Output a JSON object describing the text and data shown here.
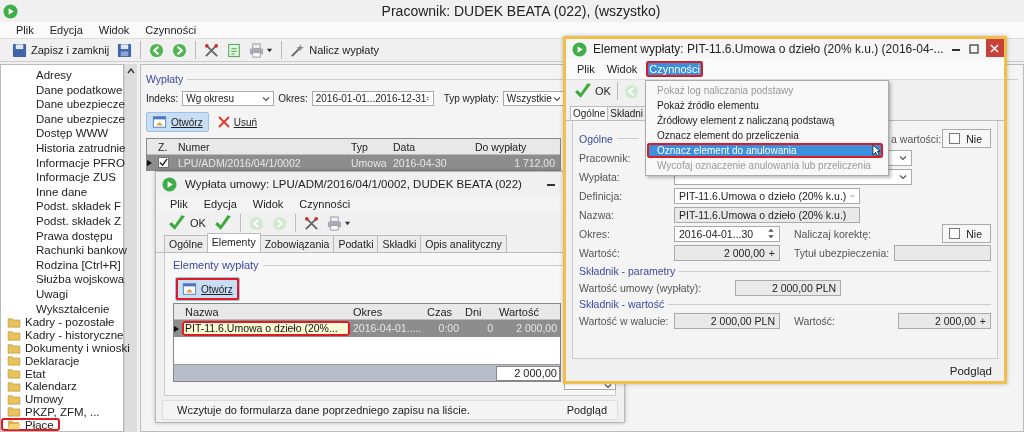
{
  "window": {
    "title": "Pracownik: DUDEK BEATA (022), (wszystko)"
  },
  "menu": [
    "Plik",
    "Edycja",
    "Widok",
    "Czynności"
  ],
  "toolbar": {
    "save_close": "Zapisz i zamknij",
    "calculate": "Nalicz wypłaty"
  },
  "sidebar": {
    "subitems": [
      "Adresy",
      "Dane podatkowe",
      "Dane ubezpiecze",
      "Dane ubezpiecze",
      "Dostęp WWW",
      "Historia zatrudnie",
      "Informacje PFRO",
      "Informacje ZUS",
      "Inne dane",
      "Podst. składek F",
      "Podst. składek Z",
      "Prawa dostępu",
      "Rachunki bankow",
      "Rodzina [Ctrl+R]",
      "Służba wojskowa",
      "Uwagi",
      "Wykształcenie"
    ],
    "folders": [
      {
        "label": "Kadry - pozostałe",
        "open": false,
        "annotated": false
      },
      {
        "label": "Kadry - historyczne",
        "open": false,
        "annotated": false
      },
      {
        "label": "Dokumenty i wnioski",
        "open": false,
        "annotated": false
      },
      {
        "label": "Deklaracje",
        "open": false,
        "annotated": false
      },
      {
        "label": "Etat",
        "open": false,
        "annotated": false
      },
      {
        "label": "Kalendarz",
        "open": false,
        "annotated": false
      },
      {
        "label": "Umowy",
        "open": false,
        "annotated": false
      },
      {
        "label": "PKZP, ZFM, ...",
        "open": false,
        "annotated": false
      },
      {
        "label": "Płace",
        "open": true,
        "annotated": true
      }
    ]
  },
  "payouts": {
    "group": "Wypłaty",
    "index_label": "Indeks:",
    "index_value": "Wg okresu",
    "period_label": "Okres:",
    "period_value": "2016-01-01...2016-12-31",
    "type_label": "Typ wypłaty:",
    "type_value": "Wszystkie",
    "open": "Otwórz",
    "delete": "Usuń",
    "check_column": "Z.",
    "columns": [
      "Numer",
      "Typ",
      "Data",
      "Do wypłaty"
    ],
    "rows": [
      {
        "selected": true,
        "checked": true,
        "cells": [
          "LPU/ADM/2016/04/1/0002",
          "Umowa",
          "2016-04-30",
          "1 712,00"
        ]
      }
    ]
  },
  "payout_window": {
    "title": "Wypłata umowy: LPU/ADM/2016/04/1/0002, DUDEK BEATA (022)",
    "menu": [
      "Plik",
      "Edycja",
      "Widok",
      "Czynności"
    ],
    "ok": "OK",
    "tabs": [
      {
        "label": "Ogólne",
        "selected": false
      },
      {
        "label": "Elementy",
        "selected": true
      },
      {
        "label": "Zobowiązania",
        "selected": false
      },
      {
        "label": "Podatki",
        "selected": false
      },
      {
        "label": "Składki",
        "selected": false
      },
      {
        "label": "Opis analityczny",
        "selected": false
      }
    ],
    "group": "Elementy wypłaty",
    "open": {
      "label": "Otwórz",
      "annotated": true
    },
    "columns": [
      "Nazwa",
      "Okres",
      "Czas",
      "Dni",
      "Wartość"
    ],
    "rows": [
      {
        "selected": true,
        "cells": [
          {
            "text": "PIT-11.6.Umowa o dzieło (20%...",
            "focused": true,
            "annotated": true
          },
          {
            "text": "2016-04-01.....",
            "focused": false,
            "annotated": false
          },
          {
            "text": "0:00",
            "focused": false,
            "annotated": false
          },
          {
            "text": "0",
            "focused": false,
            "annotated": false
          },
          {
            "text": "2 000,00",
            "focused": false,
            "annotated": false
          }
        ]
      }
    ],
    "total": "2 000,00",
    "status": "Wczytuje do formularza dane poprzedniego zapisu na liście.",
    "status_right": "Podgląd"
  },
  "element_window": {
    "title": "Element wypłaty: PIT-11.6.Umowa o dzieło (20% k.u.) (2016-04-...",
    "menu": [
      {
        "label": "Plik",
        "selected": false,
        "annotated": false
      },
      {
        "label": "Widok",
        "selected": false,
        "annotated": false
      },
      {
        "label": "Czynności",
        "selected": true,
        "annotated": true
      }
    ],
    "ok": "OK",
    "tabs": [
      {
        "label": "Ogólne",
        "selected": true
      },
      {
        "label": "Składni",
        "selected": false
      }
    ],
    "general": {
      "group": "Ogólne",
      "employee_label": "Pracownik:",
      "payout_label": "Wypłata:",
      "other_label": "a wartości:",
      "other_check": {
        "label": "Nie",
        "checked": false
      },
      "definition_label": "Definicja:",
      "definition": "PIT-11.6.Umowa o dzieło (20% k.u.)",
      "name_label": "Nazwa:",
      "name": "PIT-11.6.Umowa o dzieło (20% k.u.)",
      "period_label": "Okres:",
      "period": "2016-04-01...30",
      "correction_label": "Naliczaj korektę:",
      "correction": {
        "label": "Nie",
        "checked": false
      },
      "value_label": "Wartość:",
      "value": "2 000,00",
      "plus": "+",
      "insurance_label": "Tytuł ubezpieczenia:"
    },
    "params": {
      "group": "Składnik - parametry",
      "contract_label": "Wartość umowy (wypłaty):",
      "contract_value": "2 000,00 PLN"
    },
    "component_value": {
      "group": "Składnik - wartość",
      "currency_label": "Wartość w walucie:",
      "currency_value": "2 000,00 PLN",
      "value_label": "Wartość:",
      "value": "2 000,00",
      "plus": "+"
    },
    "status": "Podgląd",
    "actions_menu": [
      {
        "label": "Pokaż log naliczania podstawy",
        "disabled": true,
        "selected": false,
        "annotated": false
      },
      {
        "label": "Pokaż źródło elementu",
        "disabled": false,
        "selected": false,
        "annotated": false
      },
      {
        "label": "Źródłowy element z naliczaną podstawą",
        "disabled": false,
        "selected": false,
        "annotated": false
      },
      {
        "label": "Oznacz element do przeliczenia",
        "disabled": false,
        "selected": false,
        "annotated": false
      },
      {
        "label": "Oznacz element do anulowania",
        "disabled": false,
        "selected": true,
        "annotated": true
      },
      {
        "label": "Wycofaj oznaczenie anulowania lub przeliczenia",
        "disabled": true,
        "selected": false,
        "annotated": false
      }
    ]
  }
}
